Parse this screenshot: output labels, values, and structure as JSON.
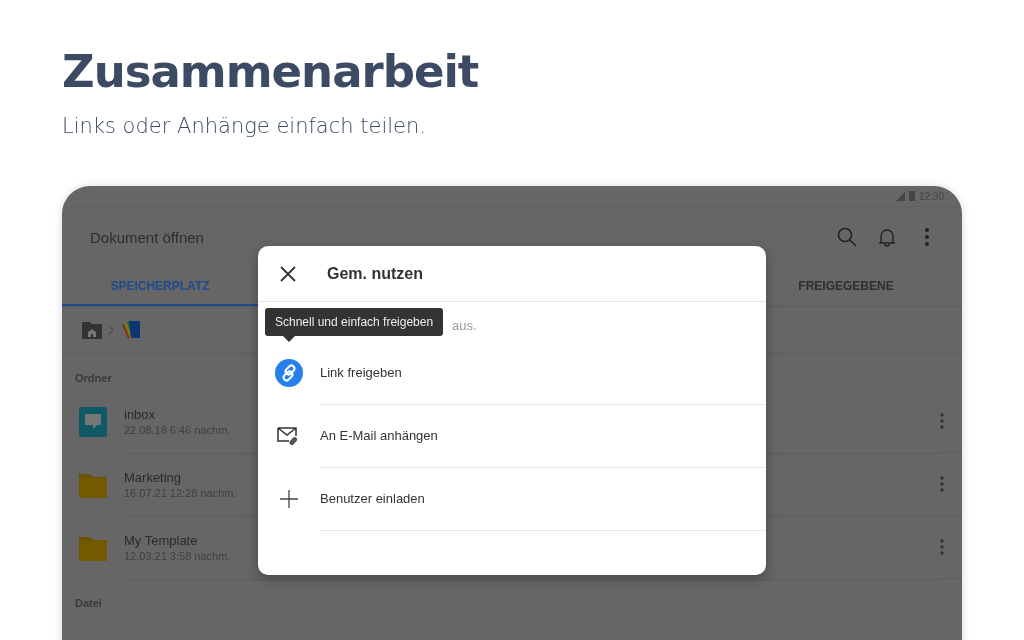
{
  "heading": {
    "title": "Zusammenarbeit",
    "subtitle": "Links oder Anhänge einfach teilen."
  },
  "status_bar": {
    "time": "12:30"
  },
  "app_bar": {
    "title": "Dokument öffnen"
  },
  "tabs": [
    {
      "label": "SPEICHERPLATZ",
      "selected": true
    },
    {
      "label": "FREIGEGEBENE",
      "selected": false
    }
  ],
  "sections": [
    {
      "label": "Ordner",
      "items": [
        {
          "name": "inbox",
          "date": "22.08.18 6:46 nachm.",
          "kind": "inbox"
        },
        {
          "name": "Marketing",
          "date": "16.07.21 12:28 nachm.",
          "kind": "folder"
        },
        {
          "name": "My Template",
          "date": "12.03.21 3:58 nachm.",
          "kind": "folder"
        }
      ]
    },
    {
      "label": "Datei"
    }
  ],
  "dialog": {
    "title": "Gem. nutzen",
    "hint_visible": "aus.",
    "tooltip": "Schnell und einfach freigeben",
    "options": [
      {
        "label": "Link freigeben",
        "kind": "link"
      },
      {
        "label": "An E-Mail anhängen",
        "kind": "email"
      },
      {
        "label": "Benutzer einladen",
        "kind": "invite"
      }
    ]
  }
}
